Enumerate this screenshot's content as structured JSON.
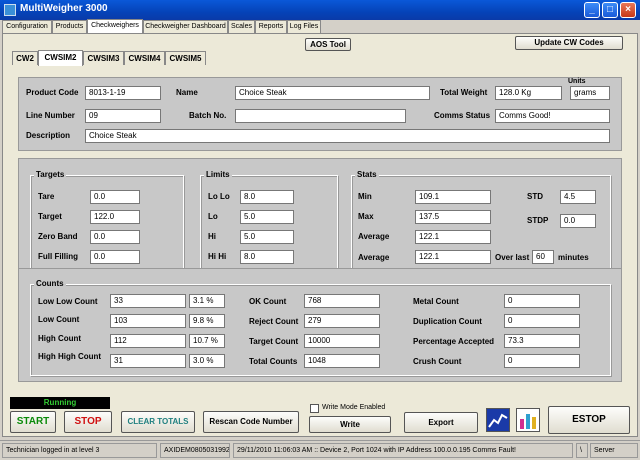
{
  "window": {
    "title": "MultiWeigher 3000"
  },
  "menu_tabs": [
    "Configuration",
    "Products",
    "Checkweighers",
    "Checkweigher Dashboard",
    "Scales",
    "Reports",
    "Log Files"
  ],
  "top_buttons": {
    "aos_tool": "AOS Tool",
    "update_cw_codes": "Update CW Codes"
  },
  "sub_tabs": [
    "CW2",
    "CWSIM2",
    "CWSIM3",
    "CWSIM4",
    "CWSIM5"
  ],
  "product": {
    "product_code_label": "Product Code",
    "product_code": "8013-1-19",
    "name_label": "Name",
    "name": "Choice Steak",
    "total_weight_label": "Total Weight",
    "total_weight": "128.0 Kg",
    "units_label": "Units",
    "units": "grams",
    "line_number_label": "Line Number",
    "line_number": "09",
    "batch_no_label": "Batch No.",
    "batch_no": "",
    "comms_status_label": "Comms Status",
    "comms_status": "Comms Good!",
    "description_label": "Description",
    "description": "Choice Steak"
  },
  "targets": {
    "title": "Targets",
    "tare_label": "Tare",
    "tare": "0.0",
    "target_label": "Target",
    "target": "122.0",
    "zero_band_label": "Zero Band",
    "zero_band": "0.0",
    "full_filling_label": "Full Filling",
    "full_filling": "0.0"
  },
  "limits": {
    "title": "Limits",
    "lolo_label": "Lo Lo",
    "lolo": "8.0",
    "lo_label": "Lo",
    "lo": "5.0",
    "hi_label": "Hi",
    "hi": "5.0",
    "hihi_label": "Hi Hi",
    "hihi": "8.0"
  },
  "stats": {
    "title": "Stats",
    "min_label": "Min",
    "min": "109.1",
    "max_label": "Max",
    "max": "137.5",
    "average_label": "Average",
    "average": "122.1",
    "average2_label": "Average",
    "average2": "122.1",
    "std_label": "STD",
    "std": "4.5",
    "stdp_label": "STDP",
    "stdp": "0.0",
    "over_last_label": "Over last",
    "over_last": "60",
    "minutes_label": "minutes"
  },
  "counts": {
    "title": "Counts",
    "low_low_label": "Low Low Count",
    "low_low": "33",
    "low_low_pct": "3.1 %",
    "low_label": "Low Count",
    "low": "103",
    "low_pct": "9.8 %",
    "high_label": "High Count",
    "high": "112",
    "high_pct": "10.7 %",
    "high_high_label": "High High Count",
    "high_high": "31",
    "high_high_pct": "3.0 %",
    "ok_label": "OK Count",
    "ok": "768",
    "reject_label": "Reject Count",
    "reject": "279",
    "target_label": "Target Count",
    "target": "10000",
    "total_label": "Total Counts",
    "total": "1048",
    "metal_label": "Metal Count",
    "metal": "0",
    "duplication_label": "Duplication Count",
    "duplication": "0",
    "pct_accepted_label": "Percentage Accepted",
    "pct_accepted": "73.3",
    "crush_label": "Crush Count",
    "crush": "0"
  },
  "controls": {
    "running": "Running",
    "start": "START",
    "stop": "STOP",
    "clear_totals": "CLEAR TOTALS",
    "rescan": "Rescan Code Number",
    "write_mode": "Write Mode Enabled",
    "write": "Write",
    "export": "Export",
    "estop": "ESTOP"
  },
  "status_bar": {
    "user": "Technician logged in at level 3",
    "id": "AXIDEM08050319921",
    "message": "29/11/2010 11:06:03 AM :: Device 2, Port 1024 with IP Address 100.0.0.195 Comms Fault!",
    "slash": "\\",
    "mode": "Server"
  },
  "colors": {
    "start": "#0a8a0a",
    "stop": "#d01010",
    "clear_totals": "#208080",
    "running_text": "#33cc33",
    "title_bar": "#0a58d8"
  }
}
